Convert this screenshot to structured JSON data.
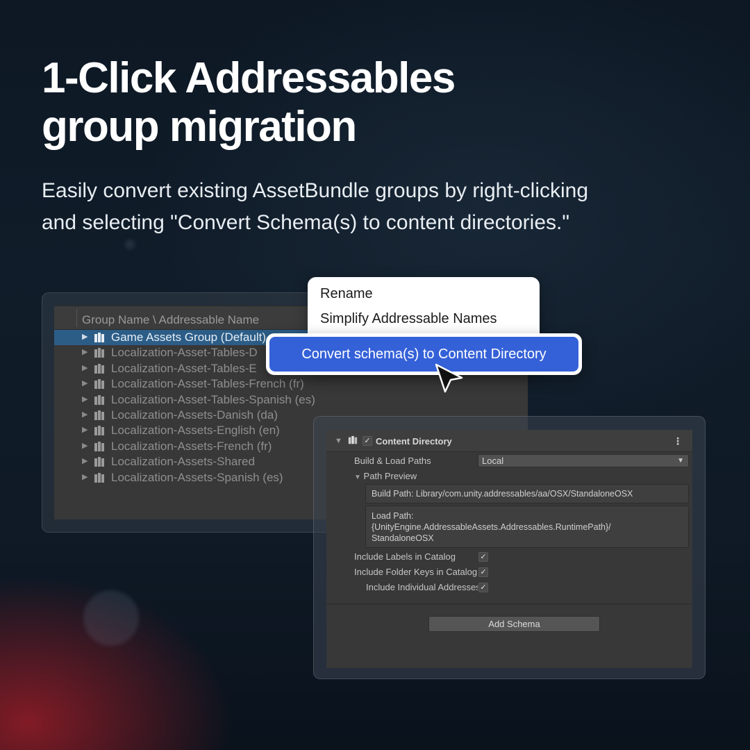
{
  "promo": {
    "headline_line1": "1-Click Addressables",
    "headline_line2": "group migration",
    "subtext_line1": "Easily convert existing AssetBundle groups by right-clicking",
    "subtext_line2": "and selecting \"Convert Schema(s) to content directories.\""
  },
  "groups_panel": {
    "column_header": "Group Name \\ Addressable Name",
    "rows": [
      {
        "label": "Game Assets Group (Default)",
        "selected": true
      },
      {
        "label": "Localization-Asset-Tables-D"
      },
      {
        "label": "Localization-Asset-Tables-E"
      },
      {
        "label": "Localization-Asset-Tables-French (fr)"
      },
      {
        "label": "Localization-Asset-Tables-Spanish (es)"
      },
      {
        "label": "Localization-Assets-Danish (da)"
      },
      {
        "label": "Localization-Assets-English (en)"
      },
      {
        "label": "Localization-Assets-French (fr)"
      },
      {
        "label": "Localization-Assets-Shared"
      },
      {
        "label": "Localization-Assets-Spanish (es)"
      }
    ]
  },
  "context_menu": {
    "items": [
      "Rename",
      "Simplify Addressable Names"
    ],
    "highlighted": "Convert schema(s) to Content Directory"
  },
  "inspector": {
    "section_title": "Content Directory",
    "enabled": true,
    "build_load_paths_label": "Build & Load Paths",
    "build_load_paths_value": "Local",
    "path_preview_label": "Path Preview",
    "build_path": "Build Path: Library/com.unity.addressables/aa/OSX/StandaloneOSX",
    "load_path_line1": "Load Path:",
    "load_path_line2": "{UnityEngine.AddressableAssets.Addressables.RuntimePath}/",
    "load_path_line3": "StandaloneOSX",
    "include_labels": {
      "label": "Include Labels in Catalog",
      "checked": true
    },
    "include_folder_keys": {
      "label": "Include Folder Keys in Catalog",
      "checked": true
    },
    "include_individual": {
      "label": "Include Individual Addresses",
      "checked": true
    },
    "add_schema_label": "Add Schema"
  },
  "colors": {
    "highlight_blue": "#3561d8",
    "selection_blue": "#2c5d87",
    "panel_bg": "#383838"
  }
}
